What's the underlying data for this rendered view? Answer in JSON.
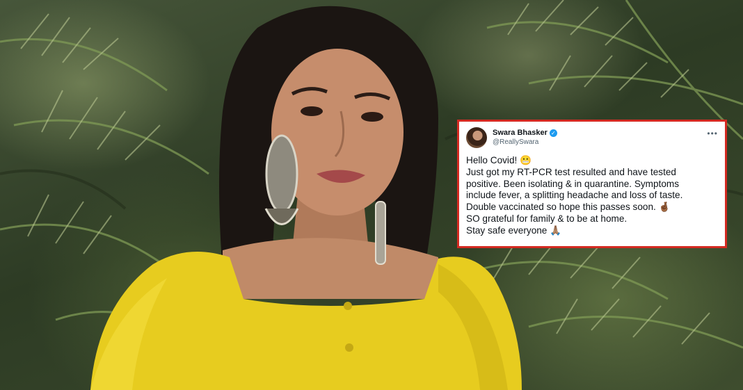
{
  "tweet": {
    "author_name": "Swara Bhasker",
    "handle": "@ReallySwara",
    "lines": [
      "Hello Covid! 😬",
      "Just got my RT-PCR test resulted and have tested",
      "positive. Been isolating & in quarantine. Symptoms",
      "include fever, a splitting headache and loss of taste.",
      "Double vaccinated so hope this passes soon. 🤞🏾",
      "SO grateful for family & to be at home.",
      "Stay safe everyone 🙏🏽"
    ],
    "verified_icon": "verified-badge-icon",
    "more_icon": "more-options-icon",
    "border_color": "#d42a22"
  },
  "scene": {
    "subject": "woman in yellow dress with silver earrings",
    "dress_color": "#e7cc1f",
    "background": "palm fronds"
  }
}
